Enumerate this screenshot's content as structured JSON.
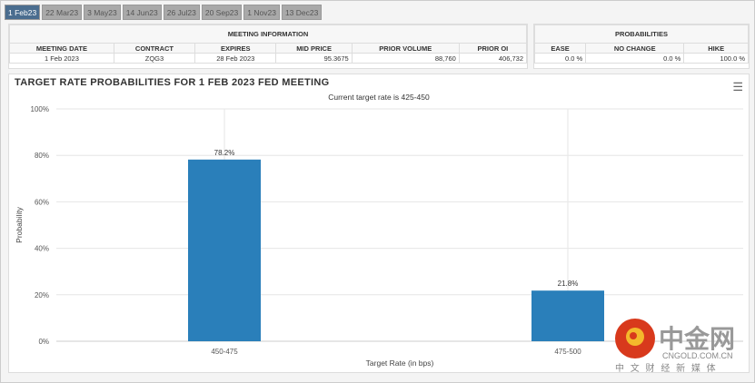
{
  "tabs": [
    "1 Feb23",
    "22 Mar23",
    "3 May23",
    "14 Jun23",
    "26 Jul23",
    "20 Sep23",
    "1 Nov23",
    "13 Dec23"
  ],
  "meeting_info": {
    "title": "MEETING INFORMATION",
    "headers": [
      "MEETING DATE",
      "CONTRACT",
      "EXPIRES",
      "MID PRICE",
      "PRIOR VOLUME",
      "PRIOR OI"
    ],
    "row": [
      "1 Feb 2023",
      "ZQG3",
      "28 Feb 2023",
      "95.3675",
      "88,760",
      "406,732"
    ]
  },
  "probabilities": {
    "title": "PROBABILITIES",
    "headers": [
      "EASE",
      "NO CHANGE",
      "HIKE"
    ],
    "row": [
      "0.0 %",
      "0.0 %",
      "100.0 %"
    ]
  },
  "chart_title": "TARGET RATE PROBABILITIES FOR 1 FEB 2023 FED MEETING",
  "chart_subtitle": "Current target rate is 425-450",
  "watermark": {
    "brand": "中金网",
    "domain": "CNGOLD.COM.CN",
    "tagline": "中 文 财 经 新 媒 体"
  },
  "chart_data": {
    "type": "bar",
    "categories": [
      "450-475",
      "475-500"
    ],
    "values": [
      78.2,
      21.8
    ],
    "labels": [
      "78.2%",
      "21.8%"
    ],
    "xlabel": "Target Rate (in bps)",
    "ylabel": "Probability",
    "ylim": [
      0,
      100
    ],
    "yticks": [
      "0%",
      "20%",
      "40%",
      "60%",
      "80%",
      "100%"
    ],
    "bar_color": "#2a7fba",
    "grid": true
  }
}
